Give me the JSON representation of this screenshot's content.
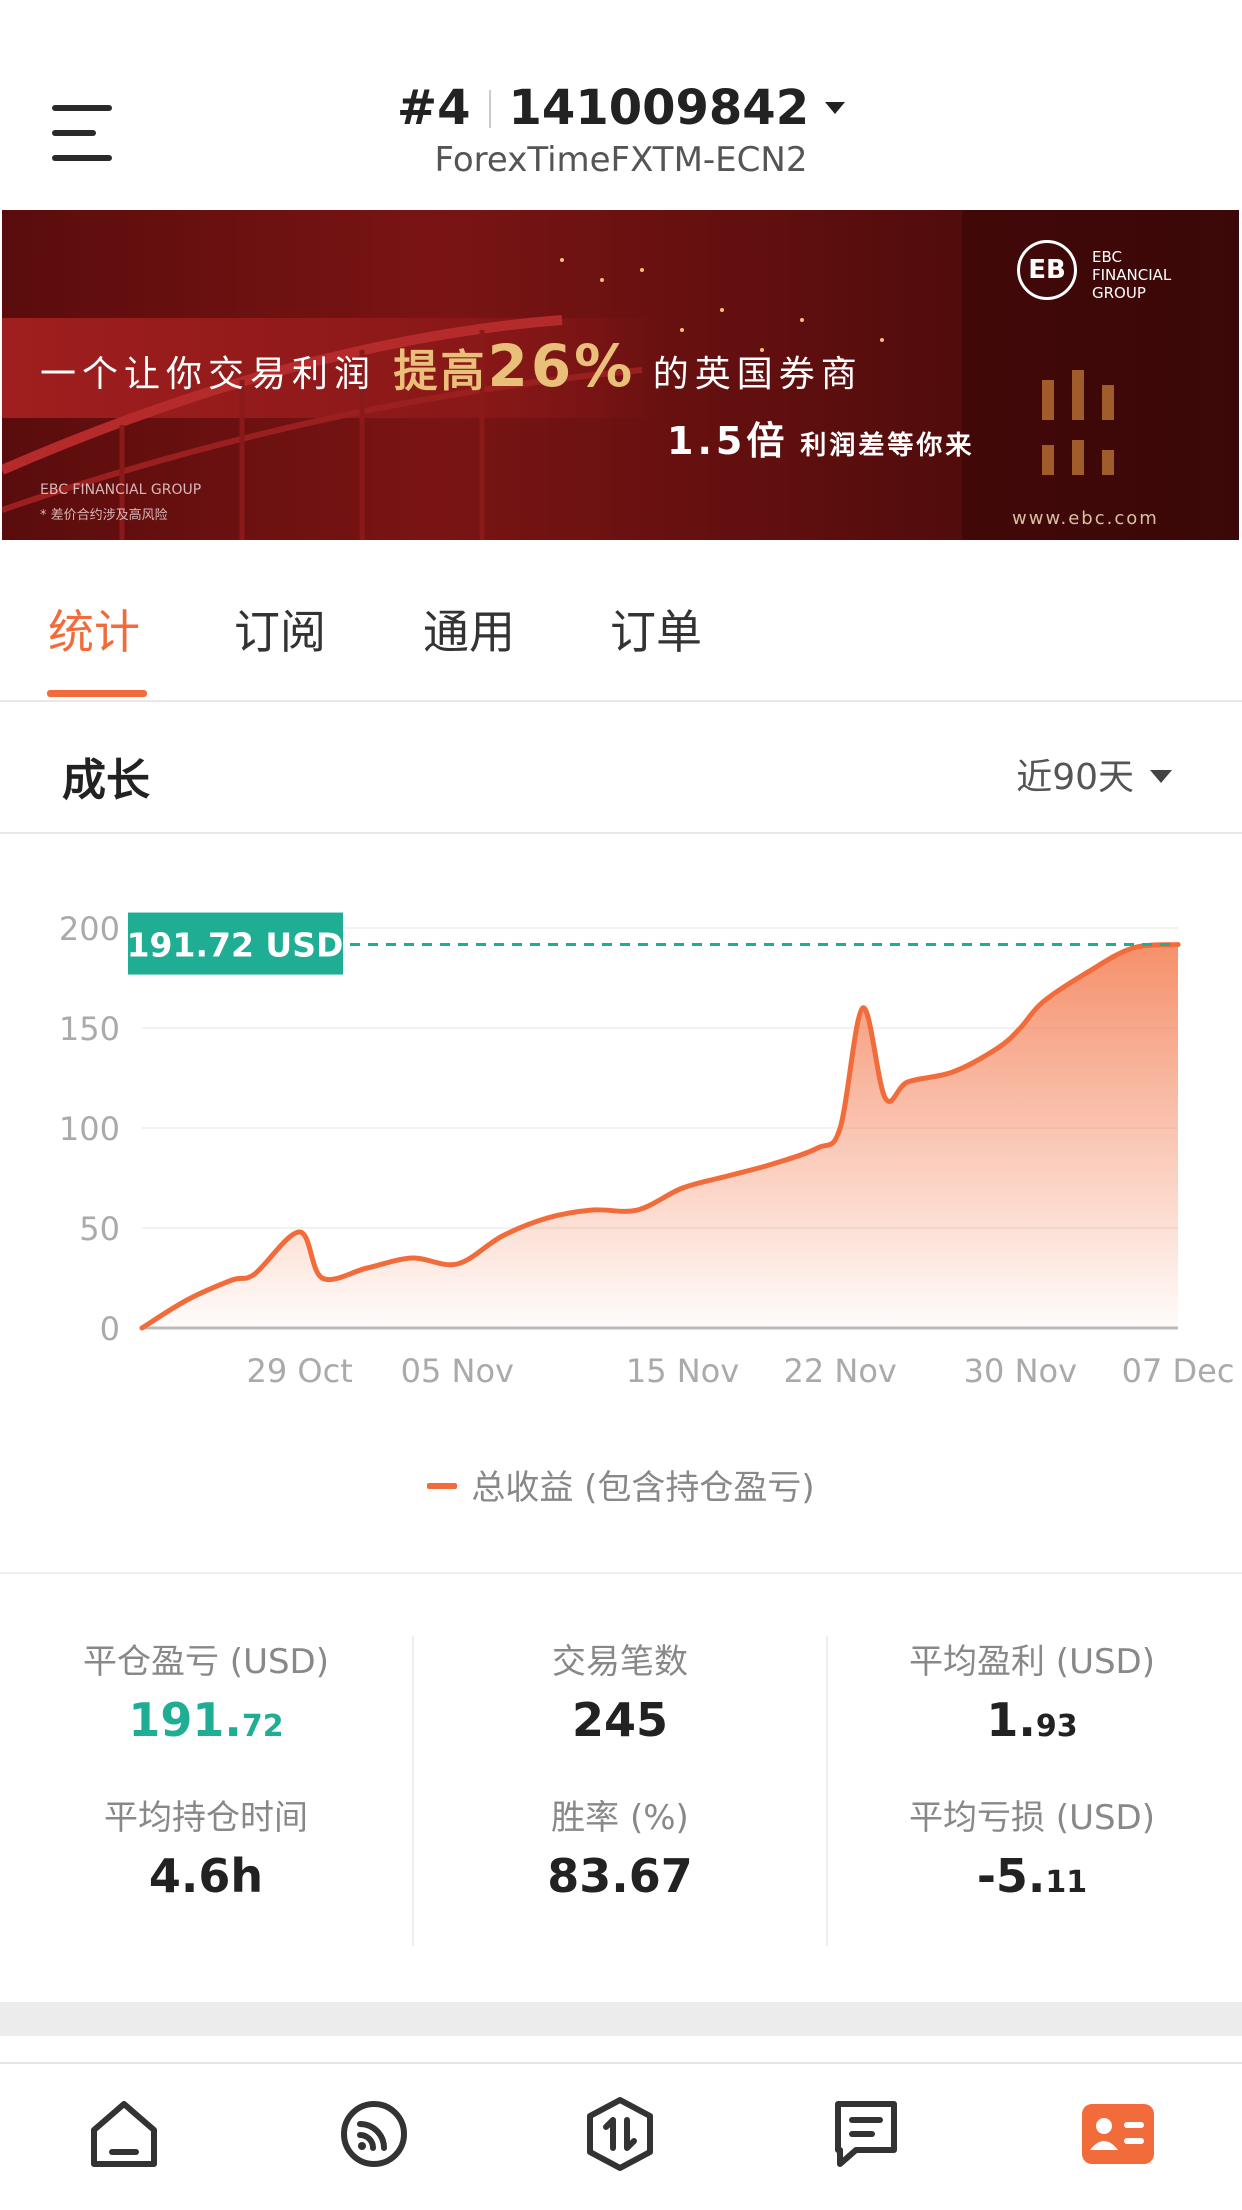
{
  "header": {
    "account_index": "#4",
    "account_number": "141009842",
    "server": "ForexTimeFXTM-ECN2"
  },
  "banner": {
    "headline_pre": "一个让你交易利润",
    "headline_hl": "提高",
    "headline_pct": "26%",
    "headline_post": "的英国券商",
    "sub_num": "1.5倍",
    "sub_text": "利润差等你来",
    "logo_text": "EB",
    "brand": "EBC\nFINANCIAL\nGROUP",
    "footer1": "EBC FINANCIAL GROUP",
    "footer2": "* 差价合约涉及高风险",
    "url": "www.ebc.com"
  },
  "tabs": [
    "统计",
    "订阅",
    "通用",
    "订单"
  ],
  "active_tab": 0,
  "section": {
    "title": "成长",
    "range": "近90天"
  },
  "chart_data": {
    "type": "area",
    "x": [
      "22 Oct",
      "24 Oct",
      "26 Oct",
      "27 Oct",
      "29 Oct",
      "30 Oct",
      "01 Nov",
      "03 Nov",
      "05 Nov",
      "07 Nov",
      "09 Nov",
      "11 Nov",
      "13 Nov",
      "15 Nov",
      "17 Nov",
      "19 Nov",
      "21 Nov",
      "22 Nov",
      "23 Nov",
      "24 Nov",
      "25 Nov",
      "27 Nov",
      "29 Nov",
      "30 Nov",
      "01 Dec",
      "03 Dec",
      "05 Dec",
      "07 Dec"
    ],
    "series": [
      {
        "name": "总收益 (包含持仓盈亏)",
        "values": [
          0,
          14,
          24,
          27,
          48,
          25,
          30,
          35,
          32,
          46,
          55,
          59,
          59,
          70,
          76,
          82,
          90,
          100,
          160,
          115,
          123,
          128,
          140,
          150,
          163,
          178,
          190,
          191.72
        ]
      }
    ],
    "xticks": [
      "29 Oct",
      "05 Nov",
      "15 Nov",
      "22 Nov",
      "30 Nov",
      "07 Dec"
    ],
    "yticks": [
      0,
      50,
      100,
      150,
      200
    ],
    "ylim": [
      0,
      200
    ],
    "marker_label": "191.72 USD",
    "marker_value": 191.72,
    "line_color": "#f26b3a",
    "marker_color": "#1fae93"
  },
  "legend": "总收益 (包含持仓盈亏)",
  "stats": {
    "closed_pl_label": "平仓盈亏 (USD)",
    "closed_pl_int": "191.",
    "closed_pl_dec": "72",
    "trades_label": "交易笔数",
    "trades_value": "245",
    "avg_profit_label": "平均盈利 (USD)",
    "avg_profit_int": "1.",
    "avg_profit_dec": "93",
    "avg_hold_label": "平均持仓时间",
    "avg_hold_value": "4.6h",
    "winrate_label": "胜率 (%)",
    "winrate_value": "83.67",
    "avg_loss_label": "平均亏损 (USD)",
    "avg_loss_int": "-5.",
    "avg_loss_dec": "11"
  },
  "bottom_nav": [
    "home-icon",
    "feed-icon",
    "trade-icon",
    "message-icon",
    "profile-card-icon"
  ],
  "colors": {
    "accent": "#f26b3a",
    "positive": "#1fae93"
  }
}
